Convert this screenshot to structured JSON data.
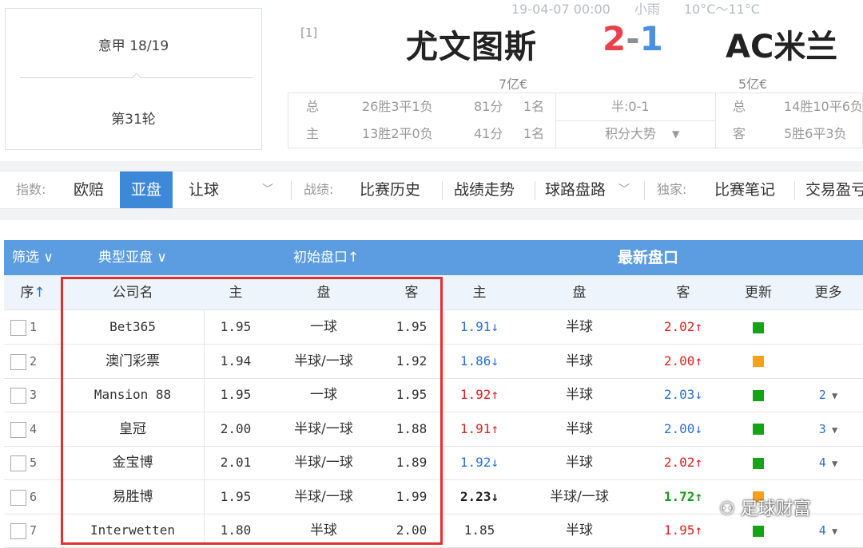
{
  "header": {
    "league": "意甲 18/19",
    "round": "第31轮",
    "datetime": "19-04-07 00:00",
    "weather": "小雨",
    "temperature": "10°C～11°C",
    "rank_tag": "[1]",
    "home_team": "尤文图斯",
    "away_team": "AC米兰",
    "score_home": "2",
    "score_sep": "-",
    "score_away": "1",
    "home_value": "7亿€",
    "away_value": "5亿€",
    "home_stats": [
      {
        "label": "总",
        "record": "26胜3平1负",
        "points": "81分",
        "rank": "1名"
      },
      {
        "label": "主",
        "record": "13胜2平0负",
        "points": "41分",
        "rank": "1名"
      }
    ],
    "half_score": "半:0-1",
    "trend_label": "积分大势",
    "away_stats": [
      {
        "label": "总",
        "record": "14胜10平6负"
      },
      {
        "label": "客",
        "record": "5胜6平3负"
      }
    ]
  },
  "nav": {
    "index_label": "指数:",
    "index_tabs": [
      "欧赔",
      "亚盘",
      "让球"
    ],
    "active_tab": "亚盘",
    "record_label": "战绩:",
    "record_tabs": [
      "比赛历史",
      "战绩走势",
      "球路盘路"
    ],
    "exclusive_label": "独家:",
    "exclusive_tabs": [
      "比赛笔记",
      "交易盈亏"
    ]
  },
  "table": {
    "filter_label": "筛选",
    "typical_label": "典型亚盘",
    "initial_label": "初始盘口",
    "latest_label": "最新盘口",
    "columns": [
      "序",
      "公司名",
      "主",
      "盘",
      "客",
      "主",
      "盘",
      "客",
      "更新",
      "更多"
    ],
    "rows": [
      {
        "seq": "1",
        "company": "Bet365",
        "init_home": "1.95",
        "init_line": "一球",
        "init_away": "1.95",
        "new_home": "1.91",
        "new_home_dir": "down",
        "new_line": "半球",
        "new_away": "2.02",
        "new_away_dir": "up",
        "update_color": "#17a317",
        "more": ""
      },
      {
        "seq": "2",
        "company": "澳门彩票",
        "init_home": "1.94",
        "init_line": "半球/一球",
        "init_away": "1.92",
        "new_home": "1.86",
        "new_home_dir": "down",
        "new_line": "半球",
        "new_away": "2.00",
        "new_away_dir": "up",
        "update_color": "#f5a11e",
        "more": ""
      },
      {
        "seq": "3",
        "company": "Mansion 88",
        "init_home": "1.95",
        "init_line": "一球",
        "init_away": "1.95",
        "new_home": "1.92",
        "new_home_dir": "up",
        "new_line": "半球",
        "new_away": "2.03",
        "new_away_dir": "down",
        "update_color": "#17a317",
        "more": "2"
      },
      {
        "seq": "4",
        "company": "皇冠",
        "init_home": "2.00",
        "init_line": "半球/一球",
        "init_away": "1.88",
        "new_home": "1.91",
        "new_home_dir": "up",
        "new_line": "半球",
        "new_away": "2.00",
        "new_away_dir": "down",
        "update_color": "#17a317",
        "more": "3"
      },
      {
        "seq": "5",
        "company": "金宝博",
        "init_home": "2.01",
        "init_line": "半球/一球",
        "init_away": "1.89",
        "new_home": "1.92",
        "new_home_dir": "down",
        "new_line": "半球",
        "new_away": "2.02",
        "new_away_dir": "up",
        "update_color": "#17a317",
        "more": "4"
      },
      {
        "seq": "6",
        "company": "易胜博",
        "init_home": "1.95",
        "init_line": "半球/一球",
        "init_away": "1.99",
        "new_home": "2.23",
        "new_home_dir": "down",
        "new_line": "半球/一球",
        "new_away": "1.72",
        "new_away_dir": "up",
        "update_color": "#f5a11e",
        "more": ""
      },
      {
        "seq": "7",
        "company": "Interwetten",
        "init_home": "1.80",
        "init_line": "半球",
        "init_away": "2.00",
        "new_home": "1.85",
        "new_home_dir": "",
        "new_line": "半球",
        "new_away": "1.95",
        "new_away_dir": "up",
        "update_color": "#17a317",
        "more": "4"
      }
    ]
  },
  "watermark": "足球财富"
}
